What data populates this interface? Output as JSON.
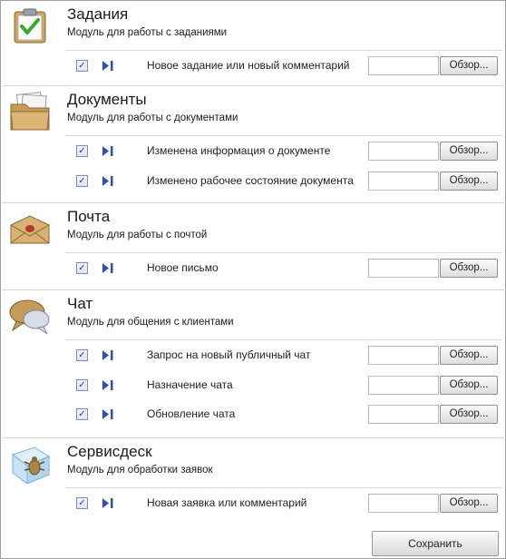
{
  "sections": [
    {
      "title": "Задания",
      "subtitle": "Модуль для работы с заданиями",
      "icon": "clipboard-check-icon",
      "rows": [
        {
          "label": "Новое задание или новый комментарий",
          "checked": true,
          "browse": "Обзор..."
        }
      ]
    },
    {
      "title": "Документы",
      "subtitle": "Модуль для работы с документами",
      "icon": "folder-documents-icon",
      "rows": [
        {
          "label": "Изменена информация о документе",
          "checked": true,
          "browse": "Обзор..."
        },
        {
          "label": "Изменено рабочее состояние документа",
          "checked": true,
          "browse": "Обзор..."
        }
      ]
    },
    {
      "title": "Почта",
      "subtitle": "Модуль для работы с почтой",
      "icon": "envelope-icon",
      "rows": [
        {
          "label": "Новое письмо",
          "checked": true,
          "browse": "Обзор..."
        }
      ]
    },
    {
      "title": "Чат",
      "subtitle": "Модуль для общения с клиентами",
      "icon": "chat-bubbles-icon",
      "rows": [
        {
          "label": "Запрос на новый публичный чат",
          "checked": true,
          "browse": "Обзор..."
        },
        {
          "label": "Назначение чата",
          "checked": true,
          "browse": "Обзор..."
        },
        {
          "label": "Обновление чата",
          "checked": true,
          "browse": "Обзор..."
        }
      ]
    },
    {
      "title": "Сервисдеск",
      "subtitle": "Модуль для обработки заявок",
      "icon": "bug-box-icon",
      "rows": [
        {
          "label": "Новая заявка или комментарий",
          "checked": true,
          "browse": "Обзор..."
        }
      ]
    }
  ],
  "save_label": "Сохранить",
  "colors": {
    "checkbox_mark": "#2a3f8a",
    "play_icon": "#3050b0",
    "divider": "#d8d8d8"
  }
}
